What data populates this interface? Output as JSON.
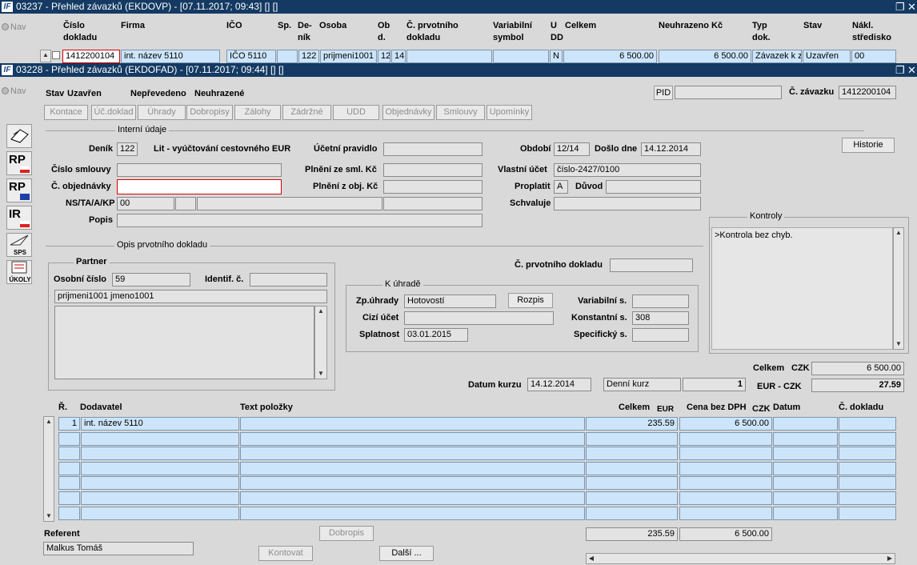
{
  "window1": {
    "title": "03237 - Přehled závazků (EKDOVP) - [07.11.2017; 09:43] [] []",
    "logo": "IF",
    "nav_label": "Nav",
    "columns": [
      "Číslo\ndokladu",
      "Firma",
      "IČO",
      "Sp.",
      "De-\nník",
      "Osoba",
      "Ob\nd.",
      "Č. prvotního\ndokladu",
      "Variabilní\nsymbol",
      "U\nDD",
      "Celkem",
      "Neuhrazeno Kč",
      "Typ\ndok.",
      "Stav",
      "Nákl.\nstředisko"
    ],
    "row": {
      "cislo": "1412200104",
      "firma": "int. název 5110",
      "ico": "IČO 5110",
      "sp": "",
      "denik": "122",
      "osoba": "prijmeni1001 jm",
      "obd1": "12",
      "obd2": "14",
      "prvotni": "",
      "var": "",
      "u": "N",
      "celkem": "6 500.00",
      "neuhrazeno": "6 500.00",
      "typ": "Závazek k z",
      "stav": "Uzavřen",
      "naklady": "00"
    }
  },
  "window2": {
    "title": "03228 - Přehled závazků (EKDOFAD) - [07.11.2017; 09:44] [] []",
    "logo": "IF",
    "nav_label": "Nav",
    "status": {
      "stav_label": "Stav",
      "stav_value": "Uzavřen",
      "neprevedeno": "Nepřevedeno",
      "neuhrazene": "Neuhrazené"
    },
    "pid_label": "PID",
    "pid_value": "",
    "zavazek_label": "Č. závazku",
    "zavazek_value": "1412200104",
    "tabs": [
      "Kontace",
      "Úč.doklad",
      "Úhrady",
      "Dobropisy",
      "Zálohy",
      "Zádržné",
      "UDD",
      "Objednávky",
      "Smlouvy",
      "Upomínky"
    ],
    "side_tools": [
      "RP",
      "RP",
      "IR",
      "SPS",
      "ÚKOLY"
    ],
    "interni": {
      "section_title": "Interní údaje",
      "denik_label": "Deník",
      "denik": "122",
      "denik_name": "Lit - vyúčtování cestovného EUR",
      "ucetni_pravidlo_label": "Účetní pravidlo",
      "ucetni_pravidlo": "",
      "obdobi_label": "Období",
      "obdobi": "12/14",
      "doslo_label": "Došlo dne",
      "doslo": "14.12.2014",
      "historie": "Historie",
      "cislo_smlouvy_label": "Číslo smlouvy",
      "cislo_smlouvy": "",
      "plneni_sml_label": "Plnění ze sml. Kč",
      "plneni_sml": "",
      "vlastni_ucet_label": "Vlastní účet",
      "vlastni_ucet": "číslo-2427/0100",
      "c_objednavky_label": "Č. objednávky",
      "c_objednavky": "",
      "plneni_obj_label": "Plnění z obj. Kč",
      "plneni_obj": "",
      "proplatit_label": "Proplatit",
      "proplatit": "A",
      "duvod_label": "Důvod",
      "duvod": "",
      "ns_label": "NS/TA/A/KP",
      "ns": "00",
      "schvaluje_label": "Schvaluje",
      "schvaluje": "",
      "popis_label": "Popis",
      "popis": ""
    },
    "kontroly": {
      "title": "Kontroly",
      "text": ">Kontrola bez chyb."
    },
    "prvotni": {
      "section_title": "Opis prvotního dokladu",
      "c_prvotniho_label": "Č. prvotního dokladu",
      "c_prvotniho": ""
    },
    "partner": {
      "title": "Partner",
      "osobni_label": "Osobní číslo",
      "osobni": "59",
      "identif_label": "Identif. č.",
      "identif": "",
      "name": "prijmeni1001 jmeno1001",
      "address": ""
    },
    "k_uhrade": {
      "title": "K úhradě",
      "zp_label": "Zp.úhrady",
      "zp": "Hotovostí",
      "rozpis": "Rozpis",
      "cizi_label": "Cizí účet",
      "cizi": "",
      "splatnost_label": "Splatnost",
      "splatnost": "03.01.2015",
      "var_label": "Variabilní s.",
      "var": "",
      "konst_label": "Konstantní s.",
      "konst": "308",
      "spec_label": "Specifický s.",
      "spec": ""
    },
    "totals": {
      "celkem_label": "Celkem",
      "celkem_cur": "CZK",
      "celkem": "6 500.00",
      "eur_czk_label": "EUR - CZK",
      "eur_czk": "27.59",
      "datum_kurzu_label": "Datum kurzu",
      "datum_kurzu": "14.12.2014",
      "kurz_type": "Denní kurz",
      "kurz_mnozstvi": "1"
    },
    "grid": {
      "headers": {
        "r": "Ř.",
        "dodavatel": "Dodavatel",
        "text": "Text položky",
        "celkem": "Celkem",
        "celkem_cur": "EUR",
        "bez_dph": "Cena bez DPH",
        "bez_dph_cur": "CZK",
        "datum": "Datum",
        "dokladu": "Č. dokladu"
      },
      "rows": [
        {
          "r": "1",
          "dodavatel": "int. název 5110",
          "text": "",
          "celkem": "235.59",
          "bez_dph": "6 500.00",
          "datum": "",
          "dokladu": ""
        },
        {
          "r": "",
          "dodavatel": "",
          "text": "",
          "celkem": "",
          "bez_dph": "",
          "datum": "",
          "dokladu": ""
        },
        {
          "r": "",
          "dodavatel": "",
          "text": "",
          "celkem": "",
          "bez_dph": "",
          "datum": "",
          "dokladu": ""
        },
        {
          "r": "",
          "dodavatel": "",
          "text": "",
          "celkem": "",
          "bez_dph": "",
          "datum": "",
          "dokladu": ""
        },
        {
          "r": "",
          "dodavatel": "",
          "text": "",
          "celkem": "",
          "bez_dph": "",
          "datum": "",
          "dokladu": ""
        },
        {
          "r": "",
          "dodavatel": "",
          "text": "",
          "celkem": "",
          "bez_dph": "",
          "datum": "",
          "dokladu": ""
        },
        {
          "r": "",
          "dodavatel": "",
          "text": "",
          "celkem": "",
          "bez_dph": "",
          "datum": "",
          "dokladu": ""
        }
      ],
      "sum_celkem": "235.59",
      "sum_bez_dph": "6 500.00"
    },
    "referent": {
      "label": "Referent",
      "value": "Malkus Tomáš"
    },
    "bottom_buttons": {
      "dobropis": "Dobropis",
      "kontovat": "Kontovat",
      "dalsi": "Další ..."
    }
  },
  "colors": {
    "titlebar": "#143a63",
    "selected_row": "#cde5fa",
    "error_border": "#dd0000"
  }
}
